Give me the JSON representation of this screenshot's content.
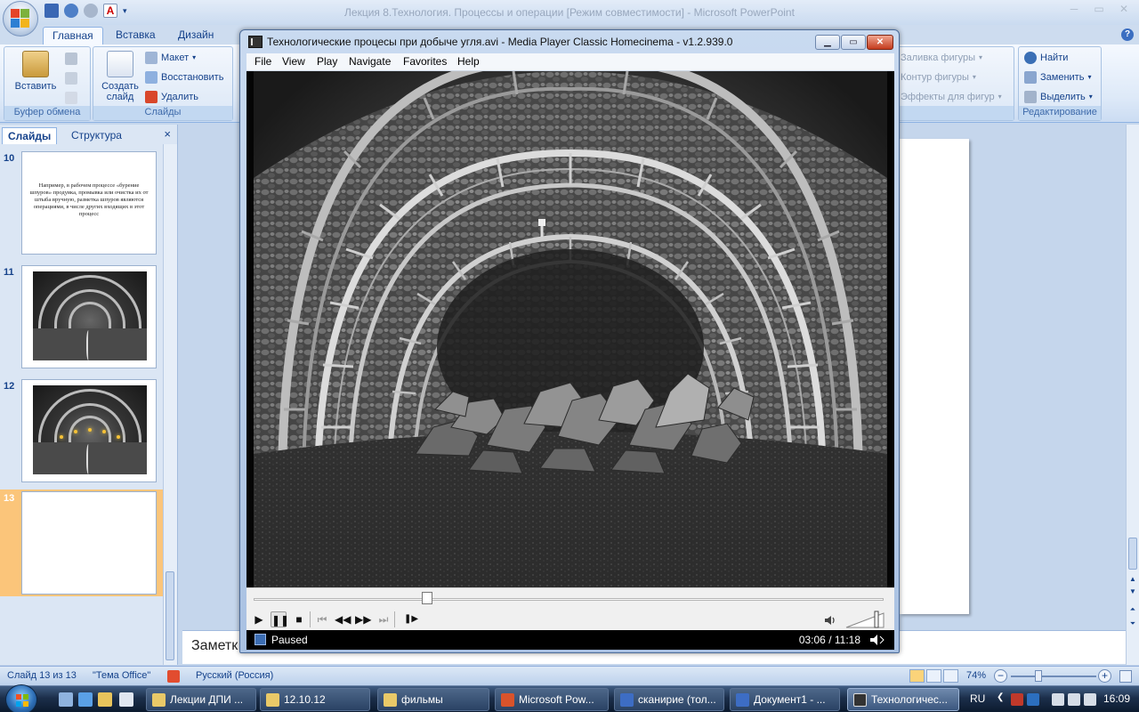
{
  "powerpoint": {
    "title": "Лекция 8.Технология. Процессы и операции [Режим совместимости] - Microsoft PowerPoint",
    "tabs": [
      "Главная",
      "Вставка",
      "Дизайн"
    ],
    "ribbon": {
      "paste_label": "Вставить",
      "clipboard_group": "Буфер обмена",
      "new_slide_label": "Создать слайд",
      "layout_label": "Макет",
      "reset_label": "Восстановить",
      "delete_label": "Удалить",
      "slides_group": "Слайды",
      "shape_fill_label": "Заливка фигуры",
      "shape_outline_label": "Контур фигуры",
      "shape_effects_label": "Эффекты для фигур",
      "find_label": "Найти",
      "replace_label": "Заменить",
      "select_label": "Выделить",
      "editing_group": "Редактирование"
    },
    "slides_pane": {
      "tab_slides": "Слайды",
      "tab_outline": "Структура",
      "close": "×",
      "thumbnails": [
        {
          "number": "10",
          "text": "Например, в рабочем процессе «бурение шпуров» продувка, промывка или очистка их от штыба вручную, разметка шпуров являются операциями, в числе других входящих в этот процесс"
        },
        {
          "number": "11"
        },
        {
          "number": "12"
        },
        {
          "number": "13"
        }
      ]
    },
    "notes_label": "Заметк",
    "status": {
      "slide_counter": "Слайд 13 из 13",
      "theme": "\"Тема Office\"",
      "language": "Русский (Россия)",
      "zoom": "74%"
    }
  },
  "media_player": {
    "title": "Технологические процесы при добыче угля.avi - Media Player Classic Homecinema - v1.2.939.0",
    "menu": [
      "File",
      "View",
      "Play",
      "Navigate",
      "Favorites",
      "Help"
    ],
    "state": "Paused",
    "time": "03:06 / 11:18",
    "seek_position": 0.275,
    "volume_level": 0.85
  },
  "taskbar": {
    "tasks": [
      {
        "label": "Лекции ДПИ ..."
      },
      {
        "label": "12.10.12"
      },
      {
        "label": "фильмы"
      },
      {
        "label": "Microsoft Pow..."
      },
      {
        "label": "сканирие (тол..."
      },
      {
        "label": "Документ1 - ..."
      },
      {
        "label": "Технологичес..."
      }
    ],
    "language": "RU",
    "clock": "16:09"
  },
  "colors": {
    "ribbon_bg": "#dde9f8",
    "selected_slide": "#fbc57a",
    "taskbar": "#1c2f4b",
    "player_status_bg": "#000000"
  }
}
